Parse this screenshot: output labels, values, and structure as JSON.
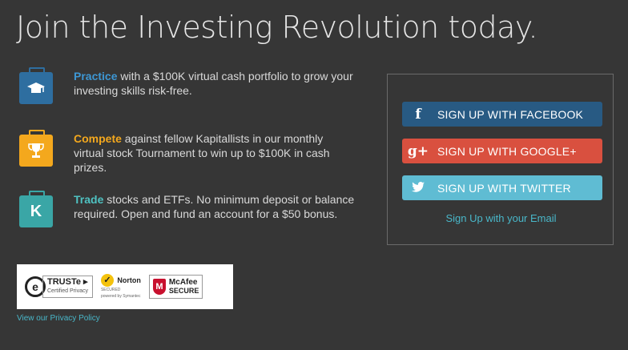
{
  "headline": "Join the Investing Revolution today.",
  "features": [
    {
      "icon": "graduation-cap-icon",
      "keyword": "Practice",
      "text": " with a $100K virtual cash portfolio to grow your investing skills risk-free.",
      "accent": "#3d97d4"
    },
    {
      "icon": "trophy-icon",
      "keyword": "Compete",
      "text": " against fellow Kapitallists in our monthly virtual stock Tournament to win up to $100K in cash prizes.",
      "accent": "#f4a81d"
    },
    {
      "icon": "k-letter-icon",
      "keyword": "Trade",
      "text": " stocks and ETFs. No minimum deposit or balance required. Open and fund an account for a $50 bonus.",
      "accent": "#4fc2c2"
    }
  ],
  "signup": {
    "facebook": {
      "icon_glyph": "f",
      "label": "SIGN UP WITH FACEBOOK",
      "color": "#285a83"
    },
    "google": {
      "icon_glyph": "g+",
      "label": "SIGN UP WITH GOOGLE+",
      "color": "#d9503f"
    },
    "twitter": {
      "icon_glyph": "🐦",
      "label": "SIGN UP WITH TWITTER",
      "color": "#5fbcd3"
    },
    "email_link": "Sign Up with your Email"
  },
  "badges": {
    "truste": {
      "glyph": "e",
      "line1": "TRUSTe ▸",
      "line2": "Certified Privacy"
    },
    "norton": {
      "glyph": "✓",
      "line1": "Norton",
      "line2": "SECURED",
      "line3": "powered by Symantec"
    },
    "mcafee": {
      "glyph": "M",
      "line1": "McAfee",
      "line2": "SECURE"
    }
  },
  "privacy_link": "View our Privacy Policy",
  "colors": {
    "background": "#363636",
    "link": "#49b7c9"
  }
}
